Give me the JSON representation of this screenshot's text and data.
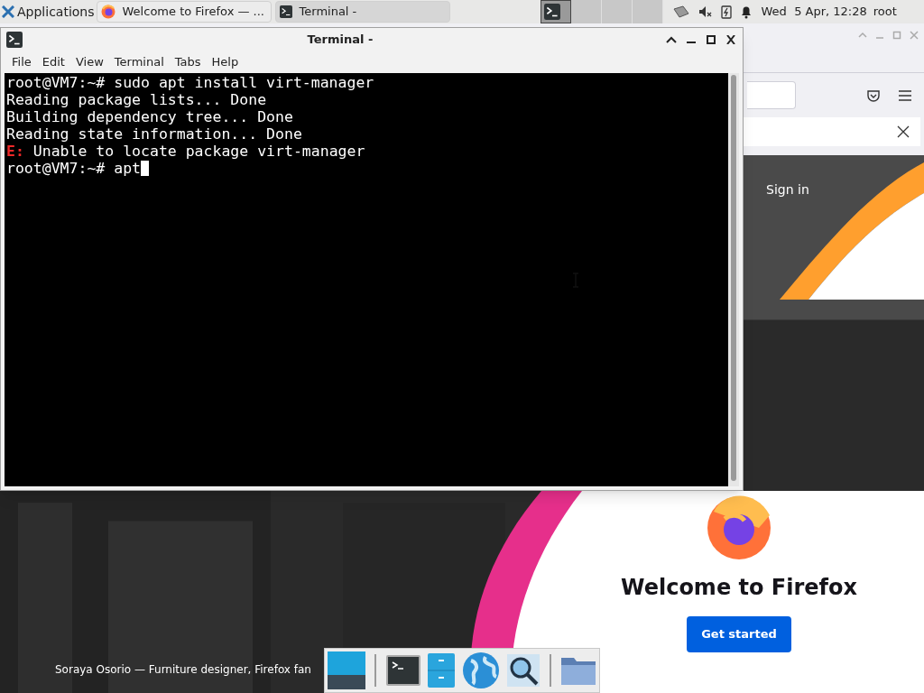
{
  "panel": {
    "app_menu": "Applications",
    "tasks": [
      {
        "label": "Welcome to Firefox — ...",
        "kind": "firefox",
        "selected": false
      },
      {
        "label": "Terminal -",
        "kind": "terminal",
        "selected": true
      }
    ],
    "workspaces": [
      {
        "selected": true
      },
      {
        "selected": false
      },
      {
        "selected": false
      },
      {
        "selected": false
      }
    ],
    "clock": "Wed  5 Apr, 12:28",
    "user": "root"
  },
  "firefox": {
    "sign_in": "Sign in",
    "welcome": "Welcome to Firefox",
    "get_started": "Get started",
    "caption": "Soraya Osorio — Furniture designer, Firefox fan"
  },
  "terminal": {
    "title": "Terminal -",
    "menu": [
      "File",
      "Edit",
      "View",
      "Terminal",
      "Tabs",
      "Help"
    ],
    "lines": [
      "root@VM7:~# sudo apt install virt-manager",
      "Reading package lists... Done",
      "Building dependency tree... Done",
      "Reading state information... Done",
      "**E:** Unable to locate package virt-manager",
      "root@VM7:~# apt"
    ]
  },
  "dock": [
    {
      "kind": "desktop"
    },
    {
      "kind": "separator"
    },
    {
      "kind": "terminal"
    },
    {
      "kind": "files"
    },
    {
      "kind": "globe"
    },
    {
      "kind": "search"
    },
    {
      "kind": "separator"
    },
    {
      "kind": "folder"
    }
  ]
}
